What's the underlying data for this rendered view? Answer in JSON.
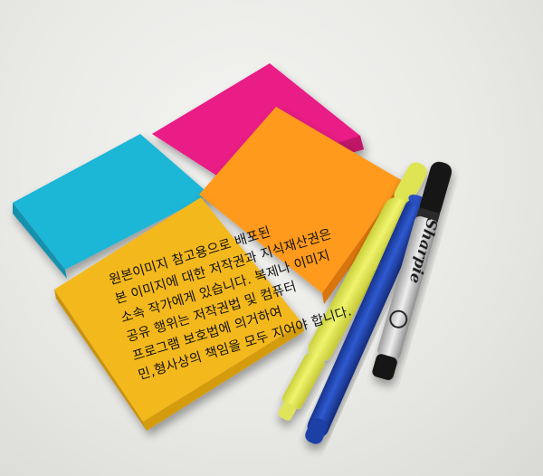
{
  "caption": {
    "lines": [
      "원본이미지 참고용으로 배포된",
      "본 이미지에 대한 저작권과 지식재산권은",
      "소속 작가에게 있습니다. 복제나 이미지",
      "공유 행위는 저작권법 및 컴퓨터",
      "프로그램 보호법에 의거하여",
      "민,형사상의 책임을 모두 지어야 합니다."
    ]
  },
  "pen_print": {
    "brand": "Sharpie"
  },
  "colors": {
    "background": "#ececea",
    "note_pink": "#ea1f86",
    "note_cyan": "#1fb6d6",
    "note_orange": "#ff9a1f",
    "note_yellow": "#f3b81c",
    "highlighter_yellow": "#e8ee5a",
    "pen_blue": "#2147b5",
    "marker_black": "#151515",
    "marker_silver": "#c9c9c9"
  }
}
